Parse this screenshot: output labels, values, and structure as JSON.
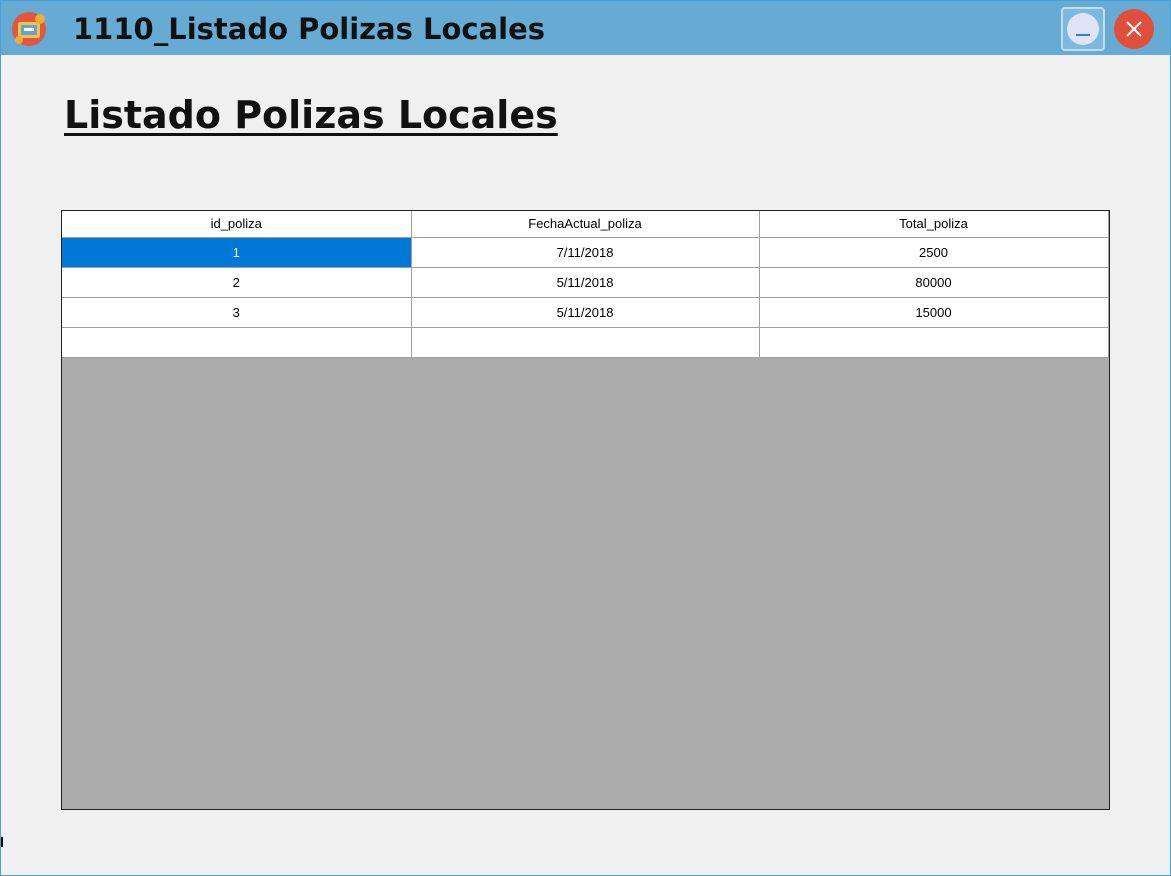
{
  "window": {
    "title": "1110_Listado Polizas Locales",
    "app_icon": "app-logo-icon",
    "minimize_icon": "minimize-icon",
    "close_icon": "close-icon"
  },
  "page": {
    "heading": "Listado Polizas Locales"
  },
  "grid": {
    "columns": [
      "id_poliza",
      "FechaActual_poliza",
      "Total_poliza"
    ],
    "rows": [
      {
        "id_poliza": "1",
        "FechaActual_poliza": "7/11/2018",
        "Total_poliza": "2500"
      },
      {
        "id_poliza": "2",
        "FechaActual_poliza": "5/11/2018",
        "Total_poliza": "80000"
      },
      {
        "id_poliza": "3",
        "FechaActual_poliza": "5/11/2018",
        "Total_poliza": "15000"
      },
      {
        "id_poliza": "",
        "FechaActual_poliza": "",
        "Total_poliza": ""
      }
    ],
    "selected_cell": {
      "row": 0,
      "column": "id_poliza"
    },
    "selection_color": "#0078d7",
    "empty_area_color": "#ababab"
  },
  "colors": {
    "titlebar": "#65abd3",
    "window_background": "#f0f0f0",
    "close_button": "#e04f3b"
  }
}
